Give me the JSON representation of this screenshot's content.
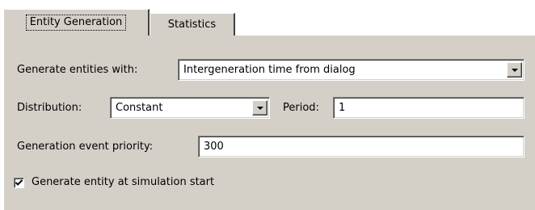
{
  "tabs": {
    "entity_generation": "Entity Generation",
    "statistics": "Statistics"
  },
  "generate_with": {
    "label": "Generate entities with:",
    "value": "Intergeneration time from dialog"
  },
  "distribution": {
    "label": "Distribution:",
    "value": "Constant"
  },
  "period": {
    "label": "Period:",
    "value": "1"
  },
  "priority": {
    "label": "Generation event priority:",
    "value": "300"
  },
  "start_checkbox": {
    "label": "Generate entity at simulation start",
    "checked": true
  },
  "icons": {
    "dropdown": "chevron-down-icon",
    "check": "check-icon"
  },
  "colors": {
    "face": "#d4d0c8",
    "field": "#ffffff",
    "shadow": "#808080"
  }
}
